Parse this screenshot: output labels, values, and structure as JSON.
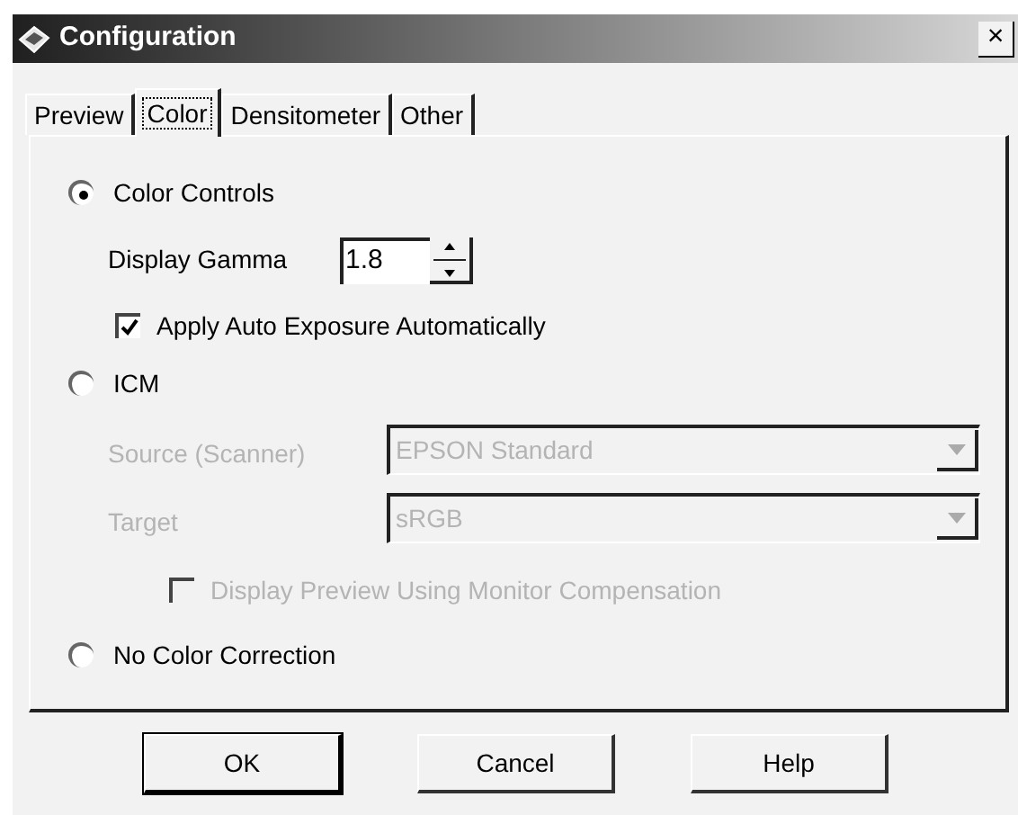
{
  "window": {
    "title": "Configuration",
    "close": "×"
  },
  "tabs": [
    {
      "label": "Preview",
      "selected": false
    },
    {
      "label": "Color",
      "selected": true
    },
    {
      "label": "Densitometer",
      "selected": false
    },
    {
      "label": "Other",
      "selected": false
    }
  ],
  "color_controls": {
    "label": "Color Controls",
    "selected": true
  },
  "display_gamma": {
    "label": "Display Gamma",
    "value": "1.8"
  },
  "auto_exposure": {
    "label": "Apply Auto Exposure Automatically",
    "checked": true
  },
  "icm": {
    "label": "ICM",
    "selected": false
  },
  "source": {
    "label": "Source (Scanner)",
    "value": "EPSON Standard",
    "disabled": true
  },
  "target": {
    "label": "Target",
    "value": "sRGB",
    "disabled": true
  },
  "monitor_compensation": {
    "label": "Display Preview Using Monitor Compensation",
    "checked": false,
    "disabled": true
  },
  "no_color_correction": {
    "label": "No Color Correction",
    "selected": false
  },
  "buttons": [
    {
      "label": "OK",
      "default": true
    },
    {
      "label": "Cancel",
      "default": false
    },
    {
      "label": "Help",
      "default": false
    }
  ]
}
